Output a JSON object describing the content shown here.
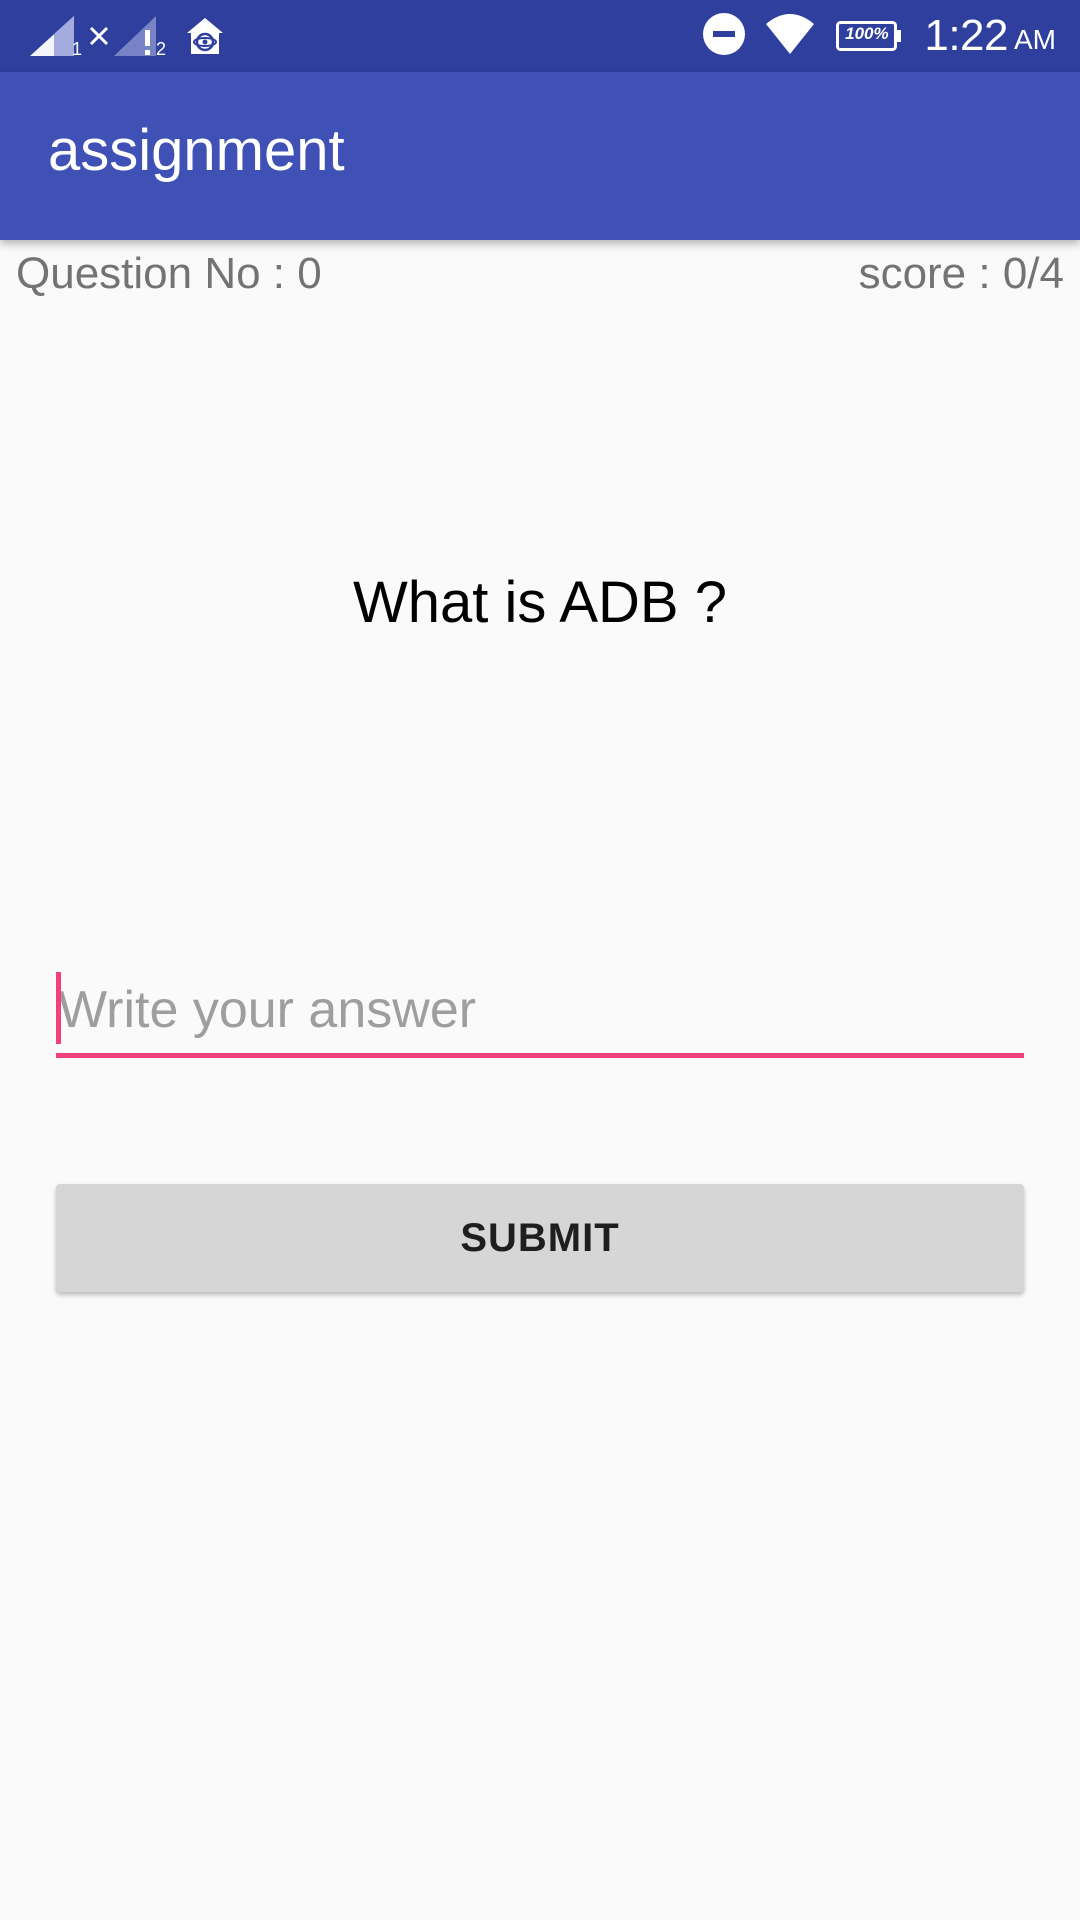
{
  "status_bar": {
    "sim1_indicator": "1",
    "sim2_indicator": "2",
    "battery_label": "100%",
    "time": "1:22",
    "ampm": "AM",
    "icons": [
      "signal-sim1-icon",
      "no-data-x-icon",
      "signal-sim2-alert-icon",
      "home-app-icon",
      "do-not-disturb-icon",
      "wifi-icon",
      "battery-icon"
    ],
    "background_color": "#2f3f9e"
  },
  "app_bar": {
    "title": "assignment",
    "background_color": "#3f51b5"
  },
  "quiz": {
    "question_no_label": "Question No : 0",
    "score_label": "score : 0/4",
    "question": "What is ADB ?",
    "answer_value": "",
    "answer_placeholder": "Write your answer",
    "accent_color": "#f0407e",
    "submit_label": "SUBMIT"
  }
}
